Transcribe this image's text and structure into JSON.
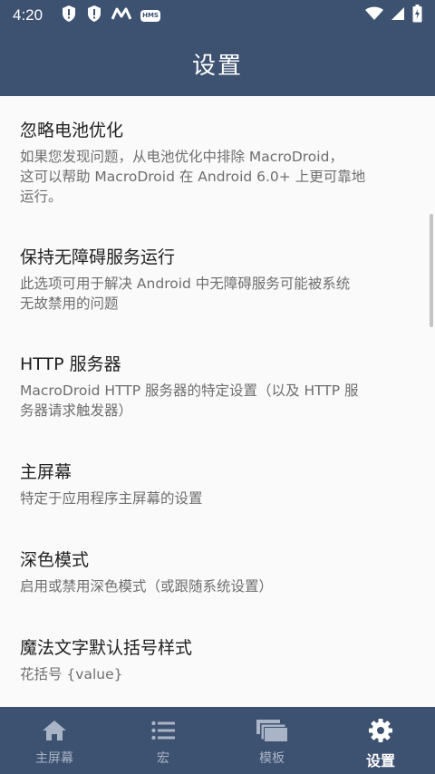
{
  "status_bar": {
    "time": "4:20",
    "badge_text": "HMS"
  },
  "app_bar": {
    "title": "设置"
  },
  "settings": [
    {
      "title": "忽略电池优化",
      "description_lines": [
        "如果您发现问题，从电池优化中排除 MacroDroid，",
        "这可以帮助 MacroDroid 在 Android 6.0+ 上更可靠地",
        "运行。"
      ]
    },
    {
      "title": "保持无障碍服务运行",
      "description_lines": [
        "此选项可用于解决 Android 中无障碍服务可能被系统",
        "无故禁用的问题"
      ]
    },
    {
      "title": "HTTP 服务器",
      "description_lines": [
        "MacroDroid HTTP 服务器的特定设置（以及 HTTP 服",
        "务器请求触发器）"
      ]
    },
    {
      "title": "主屏幕",
      "description_lines": [
        "特定于应用程序主屏幕的设置"
      ]
    },
    {
      "title": "深色模式",
      "description_lines": [
        "启用或禁用深色模式（或跟随系统设置）"
      ]
    },
    {
      "title": "魔法文字默认括号样式",
      "description_lines": [
        "花括号 {value}"
      ]
    }
  ],
  "bottom_nav": {
    "items": [
      {
        "label": "主屏幕",
        "icon": "home-icon",
        "active": false
      },
      {
        "label": "宏",
        "icon": "list-icon",
        "active": false
      },
      {
        "label": "模板",
        "icon": "templates-icon",
        "active": false
      },
      {
        "label": "设置",
        "icon": "gear-icon",
        "active": true
      }
    ]
  },
  "colors": {
    "primary": "#3d5170",
    "nav_inactive": "#a9b4c6",
    "nav_active": "#ffffff"
  }
}
